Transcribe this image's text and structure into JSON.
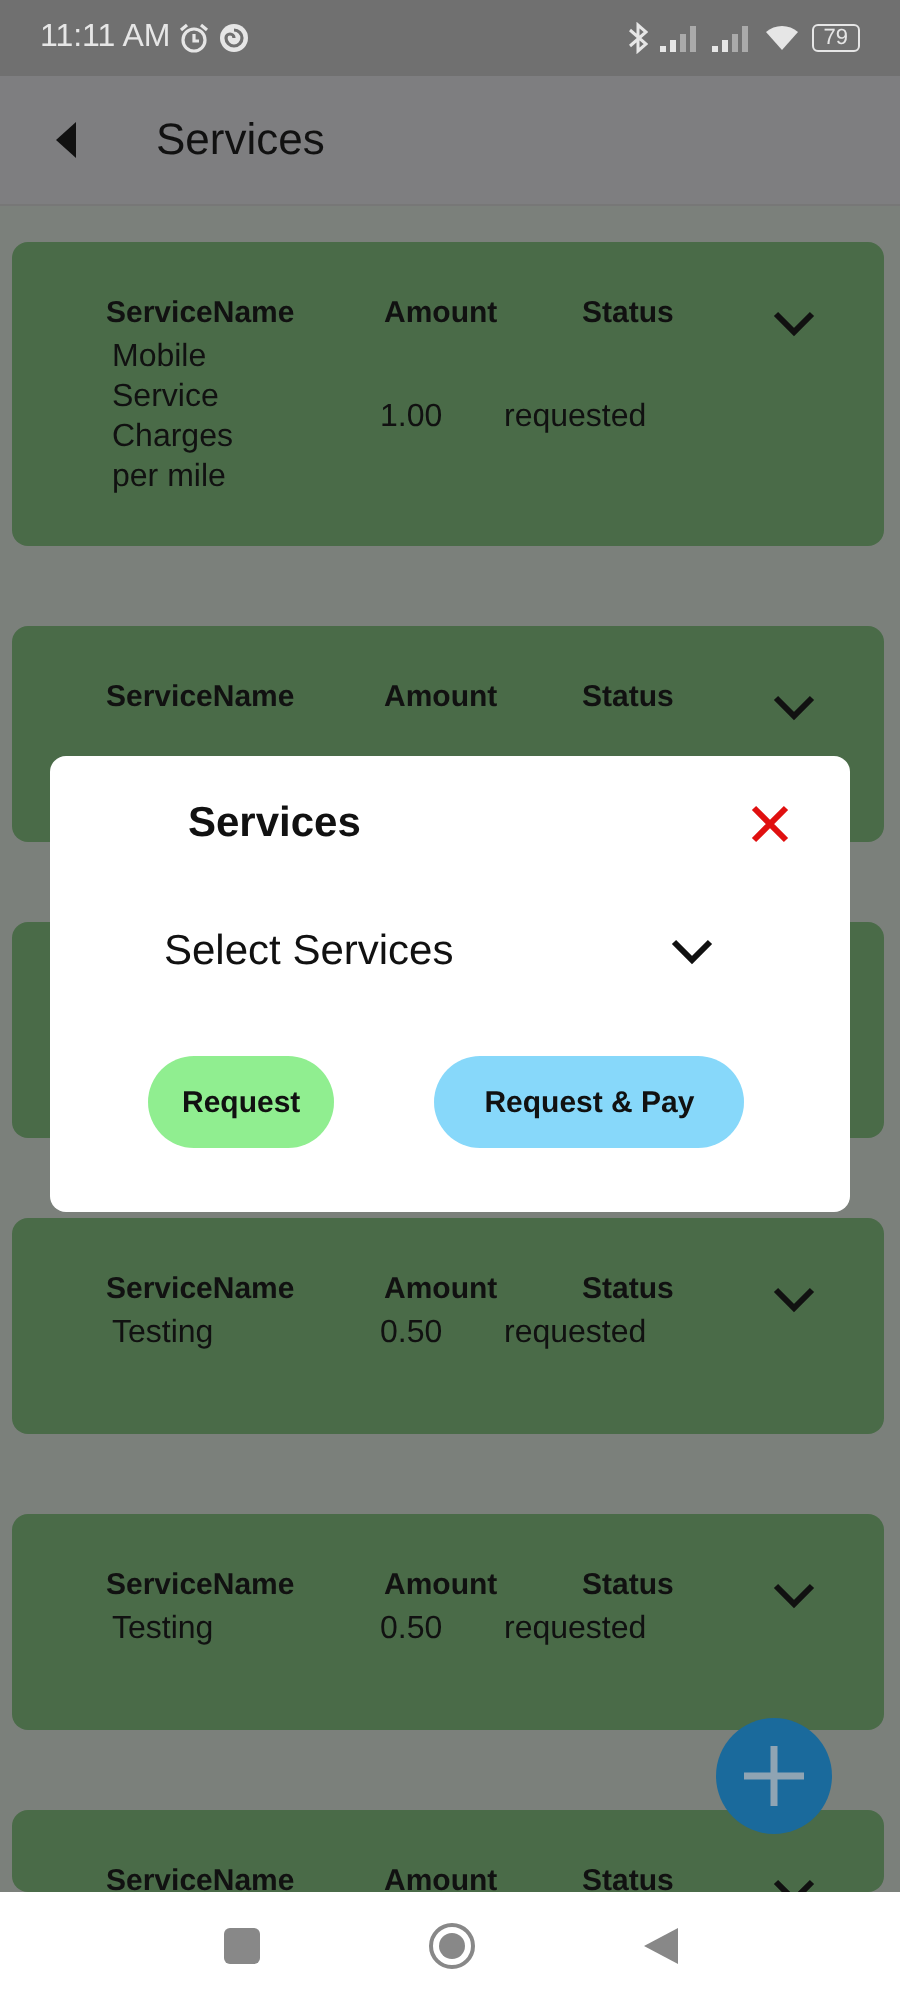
{
  "status_bar": {
    "time": "11:11 AM",
    "battery": "79"
  },
  "app_bar": {
    "title": "Services"
  },
  "services": [
    {
      "kind": "entry",
      "headers": [
        "ServiceName",
        "Amount",
        "Status"
      ],
      "row": {
        "service_name": "Mobile Service Charges per mile",
        "amount": "1.00",
        "status": "requested"
      }
    },
    {
      "kind": "entry",
      "headers": [
        "ServiceName",
        "Amount",
        "Status"
      ]
    },
    {
      "kind": "covered"
    },
    {
      "kind": "entry",
      "headers": [
        "ServiceName",
        "Amount",
        "Status"
      ],
      "row": {
        "service_name": "Testing",
        "amount": "0.50",
        "status": "requested"
      }
    },
    {
      "kind": "entry",
      "headers": [
        "ServiceName",
        "Amount",
        "Status"
      ],
      "row": {
        "service_name": "Testing",
        "amount": "0.50",
        "status": "requested"
      }
    },
    {
      "kind": "entry",
      "headers": [
        "ServiceName",
        "Amount",
        "Status"
      ]
    }
  ],
  "dialog": {
    "title": "Services",
    "select": {
      "placeholder": "Select Services"
    },
    "buttons": [
      {
        "label": "Request",
        "color": "#90ee90"
      },
      {
        "label": "Request & Pay",
        "color": "#87d8fa"
      }
    ]
  }
}
